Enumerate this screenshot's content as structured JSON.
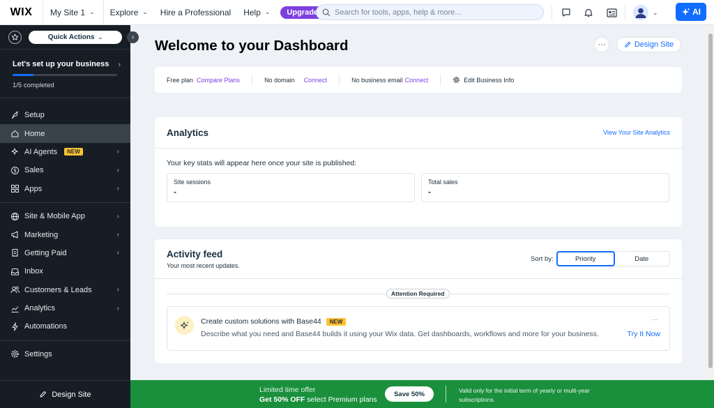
{
  "topbar": {
    "logo": "WIX",
    "site_name": "My Site 1",
    "nav": [
      "Explore",
      "Hire a Professional",
      "Help"
    ],
    "upgrade_label": "Upgrade",
    "search_placeholder": "Search for tools, apps, help & more...",
    "ai_label": "AI",
    "icons": [
      "chat-icon",
      "bell-icon",
      "profile-card-icon",
      "avatar"
    ]
  },
  "sidebar": {
    "quick_actions": "Quick Actions",
    "setup": {
      "title": "Let's set up your business",
      "progress": 0.2,
      "count_label": "1/5 completed"
    },
    "menu_groups": [
      [
        {
          "label": "Setup",
          "icon": "rocket-icon",
          "arrow": false
        },
        {
          "label": "Home",
          "icon": "home-icon",
          "arrow": false,
          "active": true
        },
        {
          "label": "AI Agents",
          "icon": "sparkle-icon",
          "arrow": true,
          "badge": "NEW"
        },
        {
          "label": "Sales",
          "icon": "dollar-icon",
          "arrow": true
        },
        {
          "label": "Apps",
          "icon": "apps-icon",
          "arrow": true
        }
      ],
      [
        {
          "label": "Site & Mobile App",
          "icon": "globe-icon",
          "arrow": true
        },
        {
          "label": "Marketing",
          "icon": "megaphone-icon",
          "arrow": true
        },
        {
          "label": "Getting Paid",
          "icon": "receipt-icon",
          "arrow": true
        },
        {
          "label": "Inbox",
          "icon": "inbox-icon",
          "arrow": false
        },
        {
          "label": "Customers & Leads",
          "icon": "people-icon",
          "arrow": true
        },
        {
          "label": "Analytics",
          "icon": "chart-icon",
          "arrow": true
        },
        {
          "label": "Automations",
          "icon": "bolt-icon",
          "arrow": false
        }
      ],
      [
        {
          "label": "Settings",
          "icon": "gear-icon",
          "arrow": false
        }
      ]
    ],
    "bottom_label": "Design Site"
  },
  "main": {
    "title": "Welcome to your Dashboard",
    "more_label": "···",
    "design_site_label": "Design Site",
    "info_bar": {
      "plan_text": "Free plan",
      "plan_link": "Compare Plans",
      "domain_text": "No domain",
      "domain_link": "Connect",
      "email_text": "No business email",
      "email_link": "Connect",
      "edit_label": "Edit Business Info"
    },
    "analytics": {
      "title": "Analytics",
      "link": "View Your Site Analytics",
      "note": "Your key stats will appear here once your site is published:",
      "stats": [
        {
          "label": "Site sessions",
          "value": "-"
        },
        {
          "label": "Total sales",
          "value": "-"
        }
      ]
    },
    "activity": {
      "title": "Activity feed",
      "subtitle": "Your most recent updates.",
      "sort_label": "Sort by:",
      "sort_options": [
        "Priority",
        "Date"
      ],
      "selected_sort": "Priority",
      "attention_label": "Attention Required",
      "item": {
        "title": "Create custom solutions with Base44",
        "badge": "NEW",
        "description": "Describe what you need and Base44 builds it using your Wix data. Get dashboards, workflows and more for your business.",
        "cta": "Try It Now",
        "more": "···"
      }
    }
  },
  "promo": {
    "line1": "Limited time offer",
    "line2_bold": "Get 50% OFF",
    "line2_rest": " select Premium plans",
    "button": "Save 50%",
    "note": "Valid only for the initial term of yearly or multi-year subscriptions."
  },
  "colors": {
    "accent_blue": "#116dff",
    "upgrade_purple": "#7d3fe0",
    "sidebar_bg": "#161d24",
    "promo_green": "#1a8f3c",
    "new_badge": "#ffc233"
  }
}
